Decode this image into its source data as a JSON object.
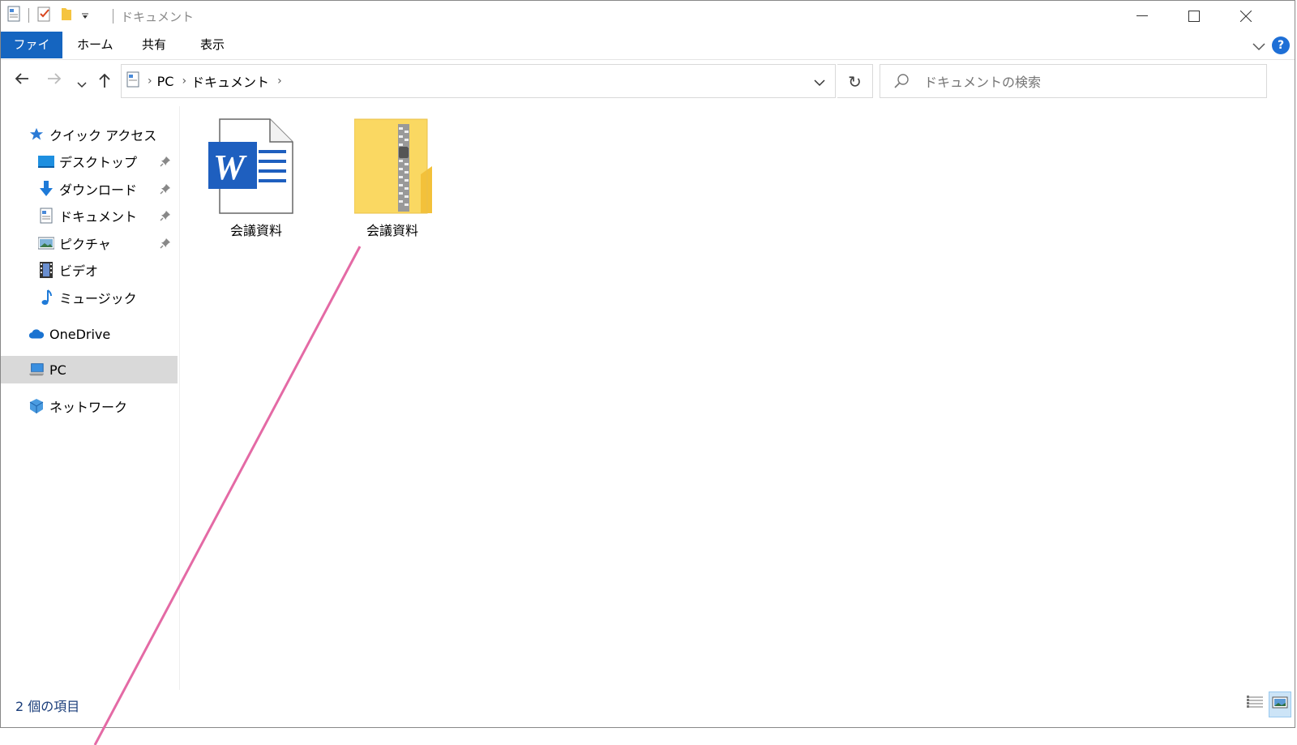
{
  "window": {
    "title": "ドキュメント",
    "controls": {
      "minimize": "—",
      "maximize": "☐",
      "close": "✕"
    }
  },
  "ribbon": {
    "tabs": [
      "ファイル",
      "ホーム",
      "共有",
      "表示"
    ],
    "help": "?"
  },
  "nav": {
    "breadcrumb": [
      "PC",
      "ドキュメント"
    ],
    "search_placeholder": "ドキュメントの検索"
  },
  "sidebar": {
    "quick_access": "クイック アクセス",
    "items": [
      {
        "label": "デスクトップ",
        "icon": "desktop-icon",
        "pinned": true
      },
      {
        "label": "ダウンロード",
        "icon": "download-icon",
        "pinned": true
      },
      {
        "label": "ドキュメント",
        "icon": "document-icon",
        "pinned": true
      },
      {
        "label": "ピクチャ",
        "icon": "picture-icon",
        "pinned": true
      },
      {
        "label": "ビデオ",
        "icon": "video-icon",
        "pinned": false
      },
      {
        "label": "ミュージック",
        "icon": "music-icon",
        "pinned": false
      }
    ],
    "onedrive": "OneDrive",
    "pc": "PC",
    "network": "ネットワーク"
  },
  "files": [
    {
      "name": "会議資料",
      "type": "word-document"
    },
    {
      "name": "会議資料",
      "type": "zip-folder"
    }
  ],
  "status": {
    "count_text": "2 個の項目"
  },
  "colors": {
    "accent": "#1565c0",
    "selected": "#d9d9d9",
    "annotation_line": "#e46aa5",
    "folder": "#f7d774"
  }
}
